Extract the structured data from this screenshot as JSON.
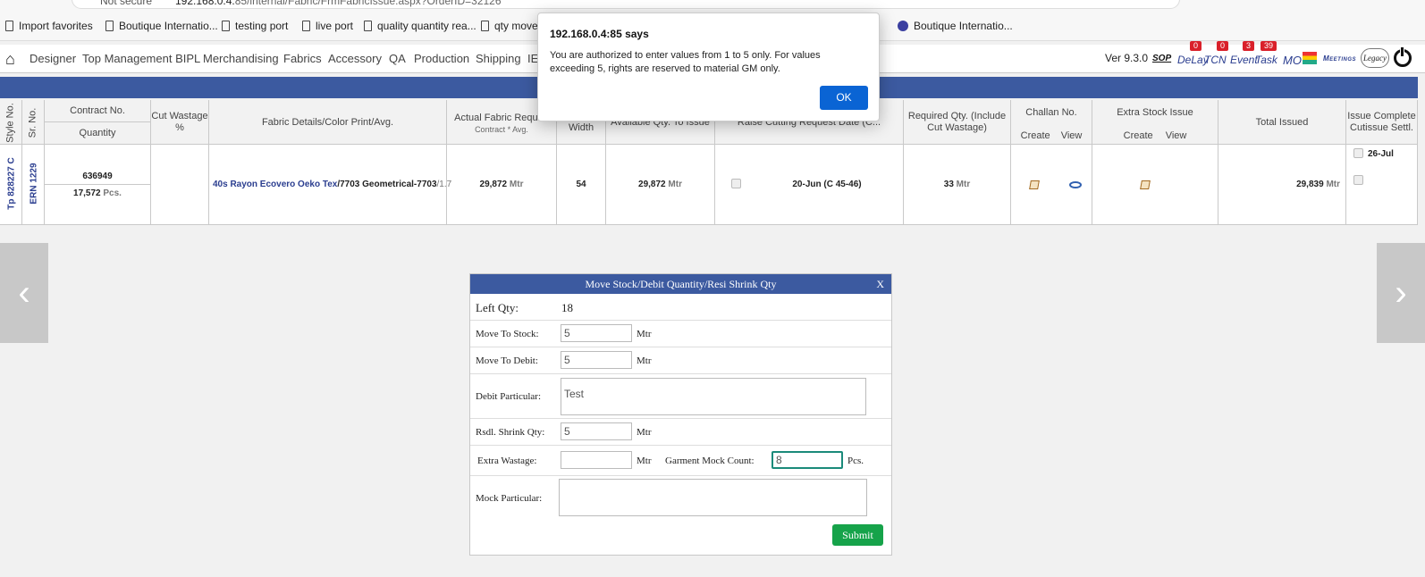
{
  "browser": {
    "security": "Not secure",
    "url_host": "192.168.0.4:",
    "url_rest": "85/internal/Fabric/FrmFabricIssue.aspx?OrderID=32126",
    "favorites": [
      {
        "label": "Import favorites"
      },
      {
        "label": "Boutique Internatio..."
      },
      {
        "label": "testing port"
      },
      {
        "label": "live port"
      },
      {
        "label": "quality quantity rea..."
      },
      {
        "label": "qty move"
      },
      {
        "label": "Boutique Internatio..."
      }
    ]
  },
  "topnav": {
    "menu": [
      "Designer",
      "Top Management BIPL",
      "Merchandising",
      "Fabrics",
      "Accessory",
      "QA",
      "Production",
      "Shipping",
      "IE"
    ],
    "version": "Ver 9.3.0",
    "sop": "SOP",
    "delay": "DeLay",
    "delay_count": "0",
    "tcn": "TCN",
    "tcn_count": "0",
    "event": "Event",
    "event_count": "3",
    "task": "Task",
    "task_count": "39",
    "mo": "MO",
    "meetings": "Meetings",
    "legacy": "Legacy"
  },
  "grid": {
    "headers": {
      "style_no": "Style No.",
      "sr_no": "Sr. No.",
      "contract_no": "Contract No.",
      "quantity": "Quantity",
      "cut_wastage": "Cut Wastage %",
      "fabric_details": "Fabric Details/Color Print/Avg.",
      "actual_fabric": "Actual Fabric Require",
      "actual_fabric_sub": "Contract * Avg.",
      "width": "Width",
      "available_qty": "Available Qty. To Issue",
      "raise_cutting": "Raise Cutting Request Date (C...",
      "required_qty": "Required Qty. (Include Cut Wastage)",
      "challan_no": "Challan No.",
      "create": "Create",
      "view": "View",
      "extra_stock": "Extra Stock Issue",
      "total_issued": "Total Issued",
      "issue_complete": "Issue Complete Cutissue Settl."
    },
    "row": {
      "style_no": "Tp 828227 C",
      "sr_no": "ERN 1229",
      "contract_no": "636949",
      "quantity": "17,572",
      "quantity_unit": "Pcs.",
      "fabric_name": "40s Rayon Ecovero Oeko Tex",
      "fabric_color": "/7703 Geometrical-7703",
      "fabric_avg": "/1.7",
      "actual_fabric": "29,872",
      "width": "54",
      "available_qty": "29,872",
      "cutting_date": "20-Jun  (C 45-46)",
      "required_qty": "33",
      "total_issued": "29,839",
      "complete_date": "26-Jul",
      "unit": "Mtr"
    }
  },
  "panel": {
    "title": "Move Stock/Debit Quantity/Resi Shrink Qty",
    "close": "X",
    "left_qty_label": "Left Qty:",
    "left_qty_value": "18",
    "move_to_stock_label": "Move To Stock:",
    "move_to_stock_value": "5",
    "move_to_debit_label": "Move To Debit:",
    "move_to_debit_value": "5",
    "debit_particular_label": "Debit Particular:",
    "debit_particular_value": "Test",
    "rsdl_shrink_label": "Rsdl. Shrink Qty:",
    "rsdl_shrink_value": "5",
    "extra_wastage_label": "Extra Wastage:",
    "extra_wastage_value": "",
    "garment_mock_label": "Garment Mock Count:",
    "garment_mock_value": "8",
    "mock_particular_label": "Mock Particular:",
    "mock_particular_value": "",
    "unit_mtr": "Mtr",
    "unit_pcs": "Pcs.",
    "submit": "Submit"
  },
  "dialog": {
    "title": "192.168.0.4:85 says",
    "message": "You are authorized to enter values from 1 to 5 only. For values exceeding 5, rights are reserved to material GM only.",
    "ok": "OK"
  },
  "nav": {
    "prev": "‹",
    "next": "›"
  },
  "colors": {
    "header_blue": "#3c5aa0",
    "submit_green": "#16a34a",
    "ok_blue": "#0a64d4",
    "badge_red": "#d9202a"
  }
}
